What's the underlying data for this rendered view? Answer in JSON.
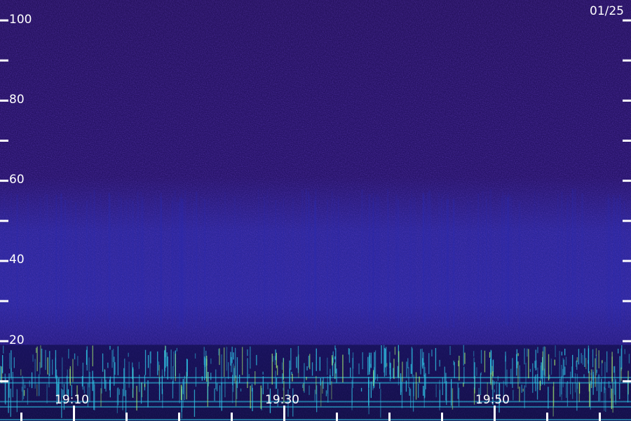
{
  "chart_data": {
    "type": "heatmap",
    "title": "",
    "xlabel": "",
    "ylabel": "",
    "date": "01/25",
    "x": {
      "label_texts": [
        "19:10",
        "19:30",
        "19:50"
      ],
      "label_minutes": [
        1150,
        1170,
        1190
      ],
      "range_minutes": [
        1143,
        1203
      ]
    },
    "y": {
      "range": [
        0,
        105
      ],
      "major_ticks": [
        20,
        40,
        60,
        80,
        100
      ],
      "minor_ticks": [
        10,
        30,
        50,
        70,
        90
      ],
      "labels": [
        "20",
        "40",
        "60",
        "80",
        "100"
      ]
    },
    "colors": {
      "background": "#1a0a55",
      "mid_band": "#2a2ab0",
      "strong": "#30c8e8",
      "peak": "#a8f070",
      "tick": "#ffffff"
    }
  }
}
